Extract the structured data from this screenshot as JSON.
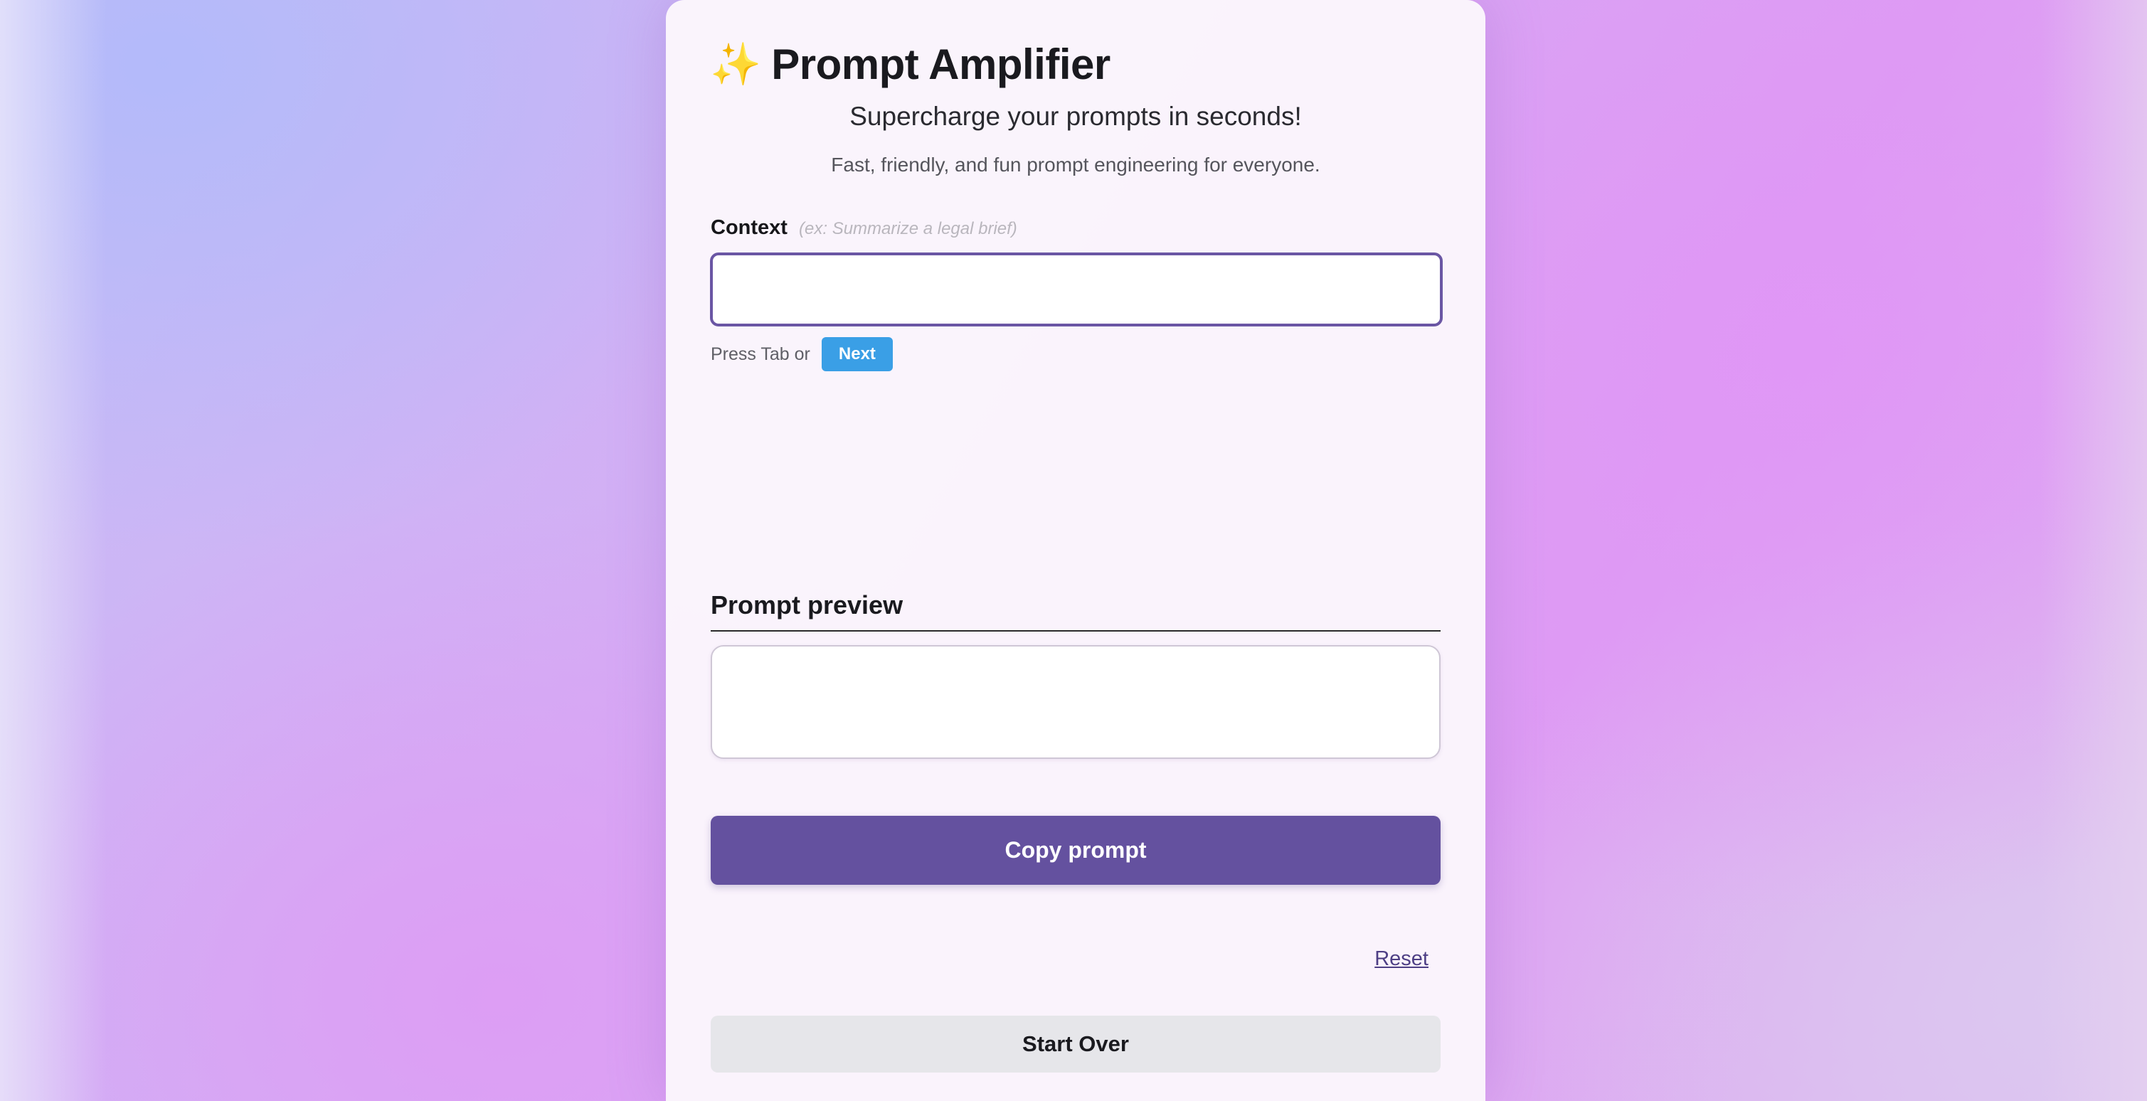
{
  "app": {
    "icon": "sparkles-icon",
    "icon_glyph": "✨",
    "title": "Prompt Amplifier",
    "subtitle": "Supercharge your prompts in seconds!",
    "tagline": "Fast, friendly, and fun prompt engineering for everyone."
  },
  "context_field": {
    "label": "Context",
    "hint": "(ex: Summarize a legal brief)",
    "value": "",
    "placeholder": ""
  },
  "navigation_hint": {
    "text": "Press Tab or",
    "next_label": "Next"
  },
  "preview": {
    "heading": "Prompt preview",
    "content": ""
  },
  "actions": {
    "copy_label": "Copy prompt",
    "reset_label": "Reset",
    "start_over_label": "Start Over"
  },
  "colors": {
    "accent": "#64519f",
    "focus_border": "#6a56a4",
    "next_button": "#3a9fe6",
    "secondary_button": "#e6e6ea"
  }
}
